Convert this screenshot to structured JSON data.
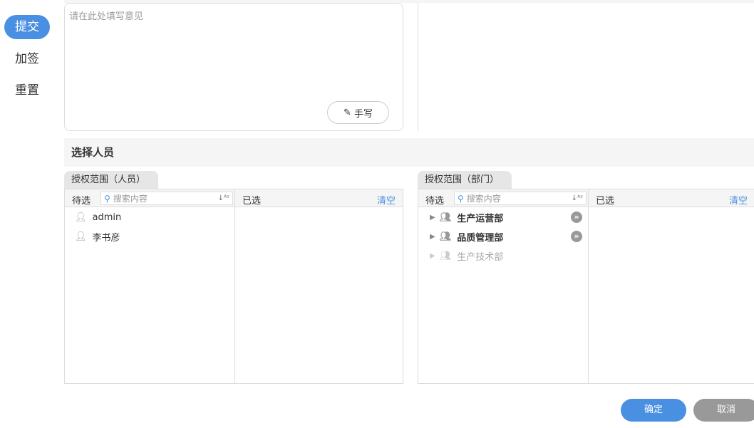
{
  "menu": {
    "items": [
      {
        "label": "提交"
      },
      {
        "label": "加签"
      },
      {
        "label": "重置"
      }
    ]
  },
  "opinion": {
    "placeholder": "请在此处填写意见",
    "handwrite_label": "手写"
  },
  "section_title": "选择人员",
  "person_panel": {
    "tab": "授权范围（人员）",
    "pending_label": "待选",
    "search_placeholder": "搜索内容",
    "selected_label": "已选",
    "clear_label": "清空",
    "items": [
      {
        "name": "admin"
      },
      {
        "name": "李书彦"
      }
    ]
  },
  "dept_panel": {
    "tab": "授权范围（部门）",
    "pending_label": "待选",
    "search_placeholder": "搜索内容",
    "selected_label": "已选",
    "clear_label": "清空",
    "items": [
      {
        "name": "生产运营部",
        "enabled": true
      },
      {
        "name": "品质管理部",
        "enabled": true
      },
      {
        "name": "生产技术部",
        "enabled": false
      }
    ]
  },
  "footer": {
    "confirm": "确定",
    "cancel": "取消"
  },
  "colors": {
    "accent": "#4a90e2",
    "cancel": "#999999"
  }
}
